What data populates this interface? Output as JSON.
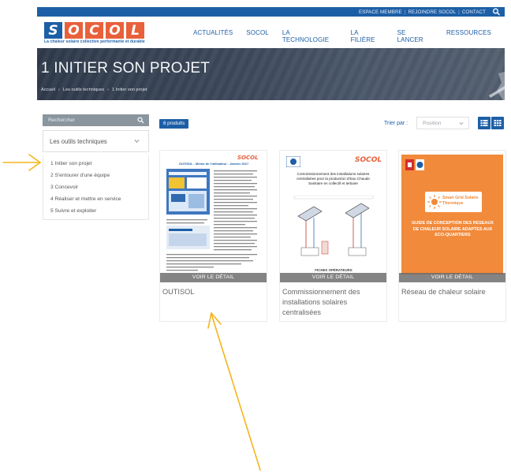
{
  "topbar": {
    "links": [
      "ESPACE MEMBRE",
      "REJOINDRE SOCOL",
      "CONTACT"
    ],
    "separator": "|"
  },
  "logo": {
    "letters": [
      "S",
      "O",
      "C",
      "O",
      "L"
    ],
    "letter_colors": [
      "#1d5fa6",
      "#e8613b",
      "#e8613b",
      "#e8613b",
      "#e8613b"
    ],
    "tagline": "La chaleur solaire collective performante et durable"
  },
  "nav": {
    "items": [
      "ACTUALITÉS",
      "SOCOL",
      "LA TECHNOLOGIE",
      "LA FILIÈRE",
      "SE LANCER",
      "RESSOURCES"
    ]
  },
  "hero": {
    "title": "1 INITIER SON PROJET",
    "breadcrumb": [
      "Accueil",
      "Les outils techniques",
      "1 Initier son projet"
    ],
    "breadcrumb_sep": "›"
  },
  "sidebar": {
    "search_placeholder": "Rechercher",
    "category": "Les outils techniques",
    "items": [
      "1 Initier son projet",
      "2 S'entourer d'une équipe",
      "3 Concevoir",
      "4 Réaliser et mettre en service",
      "5 Suivre et exploiter"
    ]
  },
  "toolbar": {
    "count": "6 produits",
    "sort_label": "Trier par :",
    "sort_value": "Position"
  },
  "products": [
    {
      "title": "OUTISOL",
      "detail": "VOIR LE DÉTAIL",
      "doc_header": "OUTISOL - Mémo de l'utilisateur - Janvier 2017"
    },
    {
      "title": "Commissionnement des installations solaires centralisées",
      "detail": "VOIR LE DÉTAIL",
      "doc_heading": "Commissionnement des installations solaires centralisées pour la production d'Eau Chaude Sanitaire en collectif et tertiaire",
      "doc_footer": "FICHES OPÉRATEURS"
    },
    {
      "title": "Réseau de chaleur solaire",
      "detail": "VOIR LE DÉTAIL",
      "cover_logo": "Smart Grid Solaire Thermique",
      "cover_text": "GUIDE DE CONCEPTION DES RESEAUX DE CHALEUR SOLAIRE ADAPTES AUX ECO-QUARTIERS"
    }
  ],
  "colors": {
    "brand_blue": "#1d5fa6",
    "brand_orange": "#e8613b",
    "annotation_arrow": "#f5b51c"
  }
}
